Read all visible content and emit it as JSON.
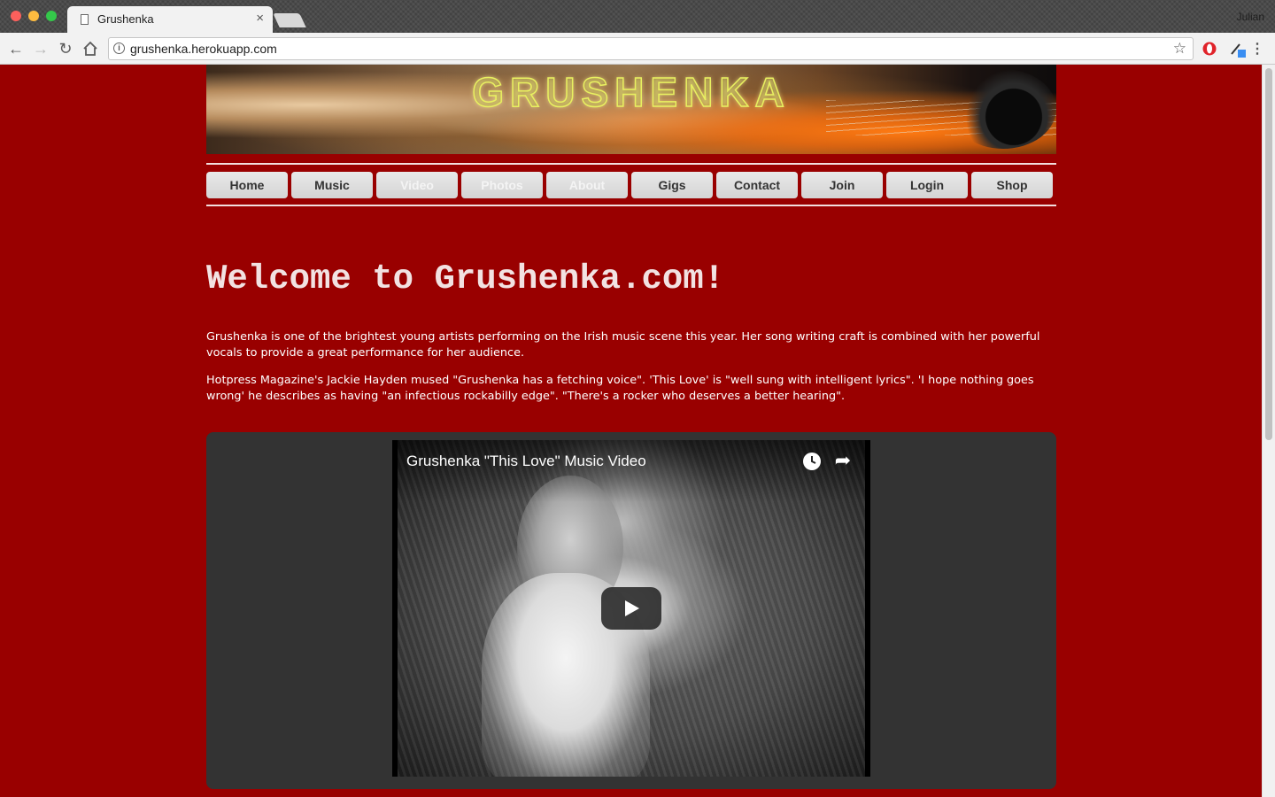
{
  "browser": {
    "tab_title": "Grushenka",
    "tab_close": "×",
    "profile_name": "Julian",
    "url": "grushenka.herokuapp.com"
  },
  "banner": {
    "title": "GRUSHENKA"
  },
  "nav": {
    "items": [
      {
        "label": "Home",
        "active": false
      },
      {
        "label": "Music",
        "active": false
      },
      {
        "label": "Video",
        "active": true
      },
      {
        "label": "Photos",
        "active": true
      },
      {
        "label": "About",
        "active": true
      },
      {
        "label": "Gigs",
        "active": false
      },
      {
        "label": "Contact",
        "active": false
      },
      {
        "label": "Join",
        "active": false
      },
      {
        "label": "Login",
        "active": false
      },
      {
        "label": "Shop",
        "active": false
      }
    ]
  },
  "main": {
    "heading": "Welcome to Grushenka.com!",
    "paragraphs": [
      "Grushenka is one of the brightest young artists performing on the Irish music scene this year. Her song writing craft is combined with her powerful vocals to provide a great performance for her audience.",
      "Hotpress Magazine's Jackie Hayden mused \"Grushenka has a fetching voice\". 'This Love' is \"well sung with intelligent lyrics\". 'I hope nothing goes wrong' he describes as having \"an infectious rockabilly edge\". \"There's a rocker who deserves a better hearing\"."
    ],
    "video": {
      "title": "Grushenka \"This Love\" Music Video"
    }
  },
  "colors": {
    "page_background": "#990000",
    "video_panel": "#333333",
    "nav_button": "#dddddd"
  }
}
